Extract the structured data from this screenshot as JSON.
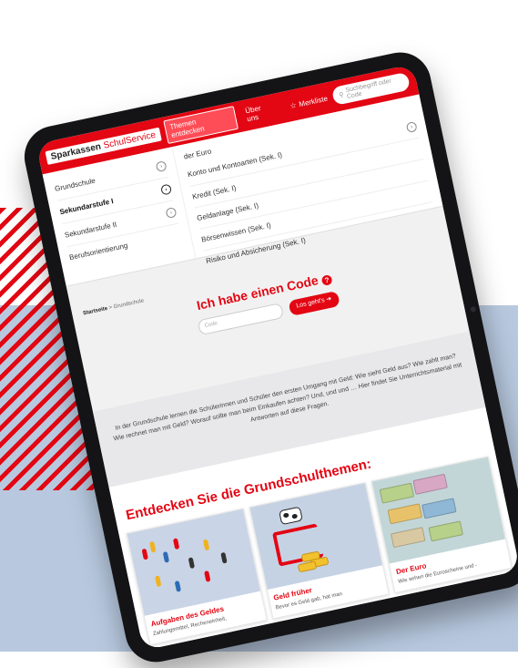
{
  "colors": {
    "brand_red": "#e30613",
    "bg_blue": "#b8c9df"
  },
  "header": {
    "logo_part1": "Sparkassen",
    "logo_part2": "SchulService",
    "nav": [
      "Themen entdecken",
      "Über uns"
    ],
    "favorites_label": "Merkliste",
    "search_placeholder": "Suchbegriff oder Code"
  },
  "menu": {
    "levels": [
      {
        "label": "Grundschule",
        "icon": "chevron-right-icon"
      },
      {
        "label": "Sekundarstufe I",
        "icon": "chevron-right-icon"
      },
      {
        "label": "Sekundarstufe II",
        "icon": "chevron-right-icon"
      },
      {
        "label": "Berufsorientierung",
        "icon": ""
      }
    ],
    "topics": [
      {
        "label": "der Euro"
      },
      {
        "label": "Konto und Kontoarten (Sek. I)"
      },
      {
        "label": "Kredit (Sek. I)"
      },
      {
        "label": "Geldanlage (Sek. I)"
      },
      {
        "label": "Börsenwissen (Sek. I)"
      },
      {
        "label": "Risiko und Absicherung (Sek. I)"
      }
    ]
  },
  "breadcrumb": {
    "home": "Startseite",
    "sep": " > ",
    "current": "Grundschule"
  },
  "code": {
    "title": "Ich habe einen Code",
    "help_icon": "?",
    "placeholder": "Code",
    "button": "Los geht's"
  },
  "intro": {
    "text": "In der Grundschule lernen die Schülerinnen und Schüler den ersten Umgang mit Geld: Wie sieht Geld aus? Wie zahlt man? Wie rechnet man mit Geld? Worauf sollte man beim Einkaufen achten? Und, und und … Hier findet Sie Unterrichtsmaterial mit Antworten auf diese Fragen."
  },
  "themes": {
    "title": "Entdecken Sie die Grundschulthemen:",
    "cards": [
      {
        "title": "Aufgaben des Geldes",
        "text": "Zahlungsmittel, Recheneinheit,"
      },
      {
        "title": "Geld früher",
        "text": "Bevor es Geld gab, hat man"
      },
      {
        "title": "Der Euro",
        "text": "Wie sehen die Euroscheine und -"
      }
    ]
  }
}
